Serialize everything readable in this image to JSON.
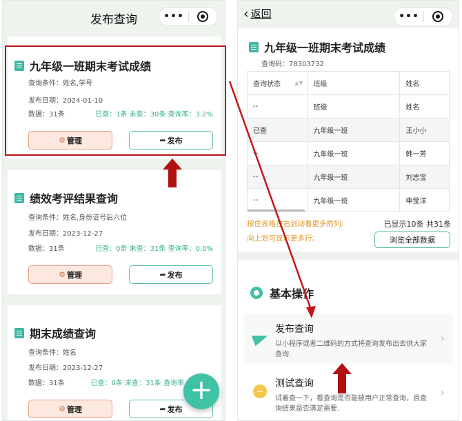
{
  "left": {
    "nav_title": "发布查询",
    "cards": [
      {
        "title": "九年级一班期末考试成绩",
        "conditions": "查询条件：姓名,学号",
        "date": "发布日期：2024-01-10",
        "count": "数据：31条",
        "stats": "已查：1条 未查：30条 查询率：3.2%",
        "manage_label": "管理",
        "publish_label": "发布"
      },
      {
        "title": "绩效考评结果查询",
        "conditions": "查询条件：姓名,身份证号后六位",
        "date": "发布日期：2023-12-27",
        "count": "数据：31条",
        "stats": "已查：0条 未查：31条 查询率：0.0%",
        "manage_label": "管理",
        "publish_label": "发布"
      },
      {
        "title": "期末成绩查询",
        "conditions": "查询条件：姓名",
        "date": "发布日期：2023-12-27",
        "count": "数据：31条",
        "stats": "已查：0条 未查：31条 查询率",
        "manage_label": "管理",
        "publish_label": "发布"
      }
    ],
    "fab_label": "+"
  },
  "right": {
    "back_label": "返回",
    "title": "九年级一班期末考试成绩",
    "query_code": "查询码：78303732",
    "table": {
      "headers": [
        "查询状态",
        "班级",
        "姓名"
      ],
      "rows": [
        [
          "--",
          "班级",
          "姓名"
        ],
        [
          "已查",
          "九年级一班",
          "王小小"
        ],
        [
          "--",
          "九年级一班",
          "韩一芳"
        ],
        [
          "--",
          "九年级一班",
          "刘志宝"
        ],
        [
          "--",
          "九年级一班",
          "申莹洋"
        ]
      ]
    },
    "hint_line1": "按住表格左右划动看更多的列;",
    "hint_line2": "向上划可显示更多行;",
    "shown_text": "已显示10条 共31条",
    "browse_label": "浏览全部数据",
    "section_title": "基本操作",
    "ops": [
      {
        "name": "发布查询",
        "desc": "以小程序或者二维码的方式将查询发布出去供大家查询."
      },
      {
        "name": "测试查询",
        "desc": "试着查一下，看查询是否能被用户正常查询，且查询结果是否满足需要."
      }
    ]
  },
  "colors": {
    "accent": "#3fc2a5",
    "annotation_red": "#b21111",
    "hint_orange": "#e0992a"
  }
}
